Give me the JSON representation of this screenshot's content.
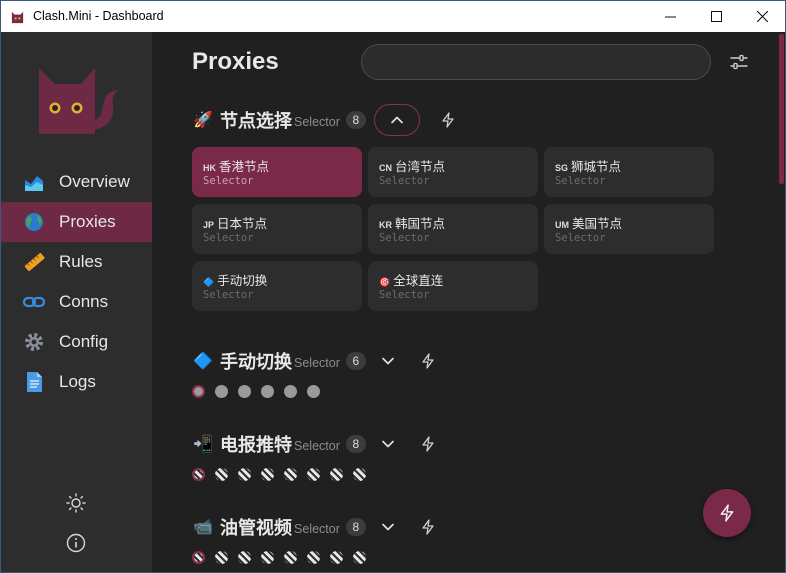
{
  "window": {
    "title": "Clash.Mini - Dashboard"
  },
  "sidebar": {
    "items": [
      {
        "label": "Overview",
        "icon": "chart-icon",
        "active": false
      },
      {
        "label": "Proxies",
        "icon": "globe-icon",
        "active": true
      },
      {
        "label": "Rules",
        "icon": "ruler-icon",
        "active": false
      },
      {
        "label": "Conns",
        "icon": "link-icon",
        "active": false
      },
      {
        "label": "Config",
        "icon": "gear-icon",
        "active": false
      },
      {
        "label": "Logs",
        "icon": "document-icon",
        "active": false
      }
    ],
    "bottom": [
      "theme-toggle-icon",
      "info-icon"
    ]
  },
  "main": {
    "title": "Proxies",
    "search": {
      "value": "",
      "placeholder": ""
    },
    "groups": [
      {
        "emoji": "🚀",
        "name": "节点选择",
        "type": "Selector",
        "count": "8",
        "expanded": true,
        "proxies": [
          {
            "flag": "HK",
            "name": "香港节点",
            "type": "Selector",
            "selected": true
          },
          {
            "flag": "CN",
            "name": "台湾节点",
            "type": "Selector",
            "selected": false
          },
          {
            "flag": "SG",
            "name": "狮城节点",
            "type": "Selector",
            "selected": false
          },
          {
            "flag": "JP",
            "name": "日本节点",
            "type": "Selector",
            "selected": false
          },
          {
            "flag": "KR",
            "name": "韩国节点",
            "type": "Selector",
            "selected": false
          },
          {
            "flag": "UM",
            "name": "美国节点",
            "type": "Selector",
            "selected": false
          },
          {
            "flag": "🔷",
            "name": "手动切换",
            "type": "Selector",
            "selected": false
          },
          {
            "flag": "🎯",
            "name": "全球直连",
            "type": "Selector",
            "selected": false
          }
        ]
      },
      {
        "emoji": "🔷",
        "name": "手动切换",
        "type": "Selector",
        "count": "6",
        "expanded": false,
        "dots": 6,
        "dot_style": "plain"
      },
      {
        "emoji": "📲",
        "name": "电报推特",
        "type": "Selector",
        "count": "8",
        "expanded": false,
        "dots": 8,
        "dot_style": "striped"
      },
      {
        "emoji": "📹",
        "name": "油管视频",
        "type": "Selector",
        "count": "8",
        "expanded": false,
        "dots": 8,
        "dot_style": "striped"
      }
    ]
  },
  "colors": {
    "accent": "#7a2a48",
    "sidebar_bg": "#2d2d2d",
    "main_bg": "#202020",
    "card_bg": "#2d2d2d"
  }
}
